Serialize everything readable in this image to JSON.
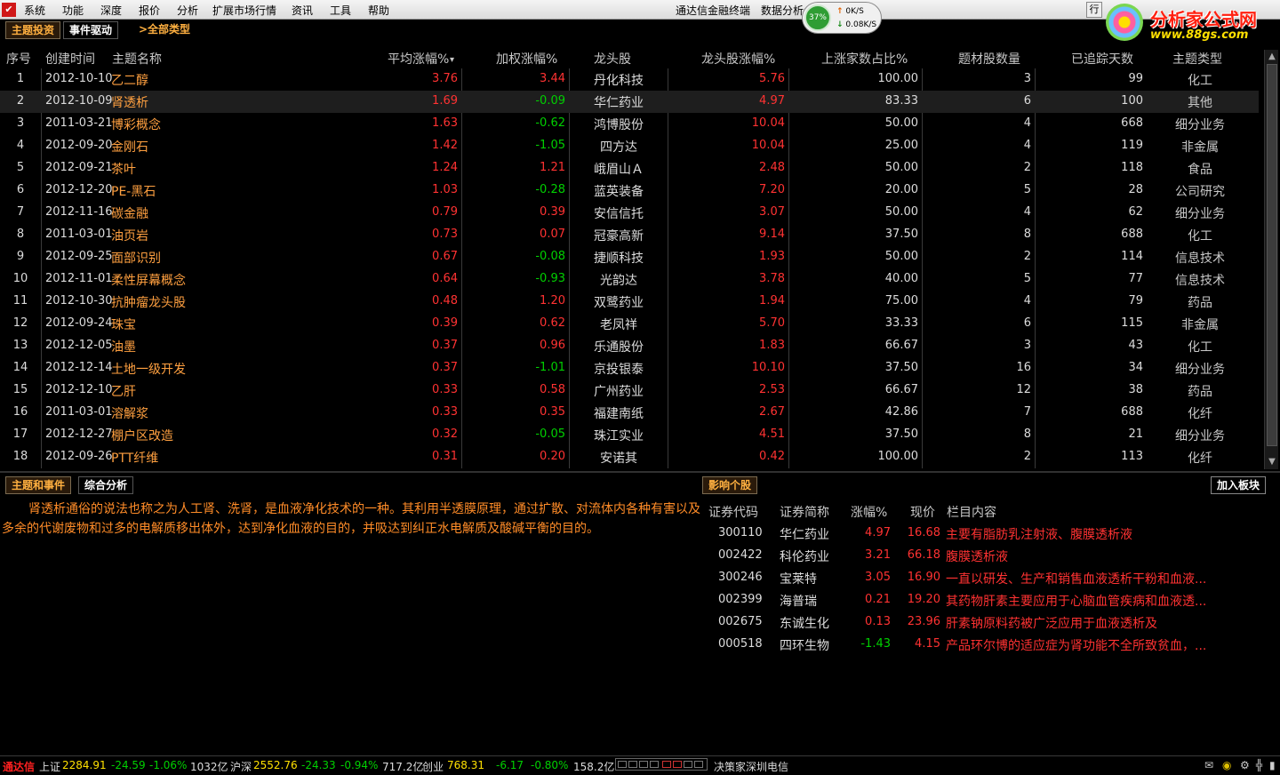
{
  "menubar": {
    "menus": [
      "系统",
      "功能",
      "深度",
      "报价",
      "分析",
      "扩展市场行情",
      "资讯",
      "工具",
      "帮助"
    ],
    "title": "通达信金融终端",
    "title2": "数据分析",
    "ctrl": "行"
  },
  "gauge": {
    "percent": "37%",
    "up": "0K/S",
    "down": "0.08K/S"
  },
  "brand": {
    "name": "分析家公式网",
    "url": "www.88gs.com"
  },
  "top_tabs": {
    "theme_invest": "主题投资",
    "event_driven": "事件驱动",
    "all_types": ">全部类型"
  },
  "table": {
    "headers": [
      "序号",
      "创建时间",
      "主题名称",
      "平均涨幅%",
      "加权涨幅%",
      "龙头股",
      "龙头股涨幅%",
      "上涨家数占比%",
      "题材股数量",
      "已追踪天数",
      "主题类型"
    ],
    "rows": [
      {
        "no": "1",
        "date": "2012-10-10",
        "name": "乙二醇",
        "avg": "3.76",
        "wgt": "3.44",
        "leader": "丹化科技",
        "lchg": "5.76",
        "ratio": "100.00",
        "count": "3",
        "days": "99",
        "type": "化工"
      },
      {
        "no": "2",
        "date": "2012-10-09",
        "name": "肾透析",
        "avg": "1.69",
        "wgt": "-0.09",
        "leader": "华仁药业",
        "lchg": "4.97",
        "ratio": "83.33",
        "count": "6",
        "days": "100",
        "type": "其他"
      },
      {
        "no": "3",
        "date": "2011-03-21",
        "name": "博彩概念",
        "avg": "1.63",
        "wgt": "-0.62",
        "leader": "鸿博股份",
        "lchg": "10.04",
        "ratio": "50.00",
        "count": "4",
        "days": "668",
        "type": "细分业务"
      },
      {
        "no": "4",
        "date": "2012-09-20",
        "name": "金刚石",
        "avg": "1.42",
        "wgt": "-1.05",
        "leader": "四方达",
        "lchg": "10.04",
        "ratio": "25.00",
        "count": "4",
        "days": "119",
        "type": "非金属"
      },
      {
        "no": "5",
        "date": "2012-09-21",
        "name": "茶叶",
        "avg": "1.24",
        "wgt": "1.21",
        "leader": "峨眉山Ａ",
        "lchg": "2.48",
        "ratio": "50.00",
        "count": "2",
        "days": "118",
        "type": "食品"
      },
      {
        "no": "6",
        "date": "2012-12-20",
        "name": "PE-黑石",
        "avg": "1.03",
        "wgt": "-0.28",
        "leader": "蓝英装备",
        "lchg": "7.20",
        "ratio": "20.00",
        "count": "5",
        "days": "28",
        "type": "公司研究"
      },
      {
        "no": "7",
        "date": "2012-11-16",
        "name": "碳金融",
        "avg": "0.79",
        "wgt": "0.39",
        "leader": "安信信托",
        "lchg": "3.07",
        "ratio": "50.00",
        "count": "4",
        "days": "62",
        "type": "细分业务"
      },
      {
        "no": "8",
        "date": "2011-03-01",
        "name": "油页岩",
        "avg": "0.73",
        "wgt": "0.07",
        "leader": "冠豪高新",
        "lchg": "9.14",
        "ratio": "37.50",
        "count": "8",
        "days": "688",
        "type": "化工"
      },
      {
        "no": "9",
        "date": "2012-09-25",
        "name": "面部识别",
        "avg": "0.67",
        "wgt": "-0.08",
        "leader": "捷顺科技",
        "lchg": "1.93",
        "ratio": "50.00",
        "count": "2",
        "days": "114",
        "type": "信息技术"
      },
      {
        "no": "10",
        "date": "2012-11-01",
        "name": "柔性屏幕概念",
        "avg": "0.64",
        "wgt": "-0.93",
        "leader": "光韵达",
        "lchg": "3.78",
        "ratio": "40.00",
        "count": "5",
        "days": "77",
        "type": "信息技术"
      },
      {
        "no": "11",
        "date": "2012-10-30",
        "name": "抗肿瘤龙头股",
        "avg": "0.48",
        "wgt": "1.20",
        "leader": "双鹭药业",
        "lchg": "1.94",
        "ratio": "75.00",
        "count": "4",
        "days": "79",
        "type": "药品"
      },
      {
        "no": "12",
        "date": "2012-09-24",
        "name": "珠宝",
        "avg": "0.39",
        "wgt": "0.62",
        "leader": "老凤祥",
        "lchg": "5.70",
        "ratio": "33.33",
        "count": "6",
        "days": "115",
        "type": "非金属"
      },
      {
        "no": "13",
        "date": "2012-12-05",
        "name": "油墨",
        "avg": "0.37",
        "wgt": "0.96",
        "leader": "乐通股份",
        "lchg": "1.83",
        "ratio": "66.67",
        "count": "3",
        "days": "43",
        "type": "化工"
      },
      {
        "no": "14",
        "date": "2012-12-14",
        "name": "土地一级开发",
        "avg": "0.37",
        "wgt": "-1.01",
        "leader": "京投银泰",
        "lchg": "10.10",
        "ratio": "37.50",
        "count": "16",
        "days": "34",
        "type": "细分业务"
      },
      {
        "no": "15",
        "date": "2012-12-10",
        "name": "乙肝",
        "avg": "0.33",
        "wgt": "0.58",
        "leader": "广州药业",
        "lchg": "2.53",
        "ratio": "66.67",
        "count": "12",
        "days": "38",
        "type": "药品"
      },
      {
        "no": "16",
        "date": "2011-03-01",
        "name": "溶解浆",
        "avg": "0.33",
        "wgt": "0.35",
        "leader": "福建南纸",
        "lchg": "2.67",
        "ratio": "42.86",
        "count": "7",
        "days": "688",
        "type": "化纤"
      },
      {
        "no": "17",
        "date": "2012-12-27",
        "name": "棚户区改造",
        "avg": "0.32",
        "wgt": "-0.05",
        "leader": "珠江实业",
        "lchg": "4.51",
        "ratio": "37.50",
        "count": "8",
        "days": "21",
        "type": "细分业务"
      },
      {
        "no": "18",
        "date": "2012-09-26",
        "name": "PTT纤维",
        "avg": "0.31",
        "wgt": "0.20",
        "leader": "安诺其",
        "lchg": "0.42",
        "ratio": "100.00",
        "count": "2",
        "days": "113",
        "type": "化纤"
      }
    ]
  },
  "left_tabs": {
    "theme_event": "主题和事件",
    "analysis": "综合分析"
  },
  "description": "肾透析通俗的说法也称之为人工肾、洗肾，是血液净化技术的一种。其利用半透膜原理，通过扩散、对流体内各种有害以及多余的代谢废物和过多的电解质移出体外，达到净化血液的目的，并吸达到纠正水电解质及酸碱平衡的目的。",
  "stocks_panel": {
    "tab": "影响个股",
    "add_btn": "加入板块",
    "headers": [
      "证券代码",
      "证券简称",
      "涨幅%",
      "现价",
      "栏目内容"
    ],
    "rows": [
      {
        "code": "300110",
        "name": "华仁药业",
        "chg": "4.97",
        "price": "16.68",
        "info": "主要有脂肪乳注射液、腹膜透析液"
      },
      {
        "code": "002422",
        "name": "科伦药业",
        "chg": "3.21",
        "price": "66.18",
        "info": "腹膜透析液"
      },
      {
        "code": "300246",
        "name": "宝莱特",
        "chg": "3.05",
        "price": "16.90",
        "info": "一直以研发、生产和销售血液透析干粉和血液..."
      },
      {
        "code": "002399",
        "name": "海普瑞",
        "chg": "0.21",
        "price": "19.20",
        "info": "其药物肝素主要应用于心脑血管疾病和血液透..."
      },
      {
        "code": "002675",
        "name": "东诚生化",
        "chg": "0.13",
        "price": "23.96",
        "info": "肝素钠原料药被广泛应用于血液透析及"
      },
      {
        "code": "000518",
        "name": "四环生物",
        "chg": "-1.43",
        "price": "4.15",
        "info": "产品环尔博的适应症为肾功能不全所致贫血，..."
      }
    ]
  },
  "statusbar": {
    "logo": "通达信",
    "sh_label": "上证",
    "sh_val": "2284.91",
    "sh_chg": "-24.59",
    "sh_pct": "-1.06%",
    "sh_amt": "1032亿",
    "hs_label": "沪深",
    "hs_val": "2552.76",
    "hs_chg": "-24.33",
    "hs_pct": "-0.94%",
    "hs_amt": "717.2亿",
    "cy_label": "创业",
    "cy_val": "768.31",
    "cy_chg": "-6.17",
    "cy_pct": "-0.80%",
    "cy_amt": "158.2亿",
    "server": "决策家深圳电信"
  },
  "colors": {
    "up": "#ff3232",
    "down": "#00d000",
    "accent": "#ffa040",
    "background": "#000000"
  }
}
